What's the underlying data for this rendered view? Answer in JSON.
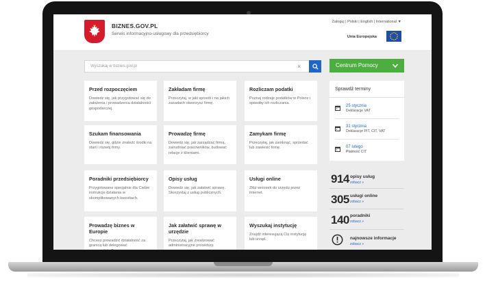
{
  "header": {
    "site_name": "BIZNES.GOV.PL",
    "site_sub": "Serwis informacyjno-usługowy dla przedsiębiorcy",
    "top_links": "Zaloguj | Polski | English | International ▼",
    "eu_label": "Unia Europejska"
  },
  "search": {
    "placeholder": "Wyszukaj w biznes.gov.pl",
    "clear_glyph": "×",
    "icon": "search-icon"
  },
  "help": {
    "label": "Centrum Pomocy",
    "icon": "chevron-down-icon"
  },
  "tiles": [
    {
      "title": "Przed rozpoczęciem",
      "desc": "Dowiedz się, jak przygotować się do założenia i prowadzenia działalności gospodarczej."
    },
    {
      "title": "Zakładam firmę",
      "desc": "Przeczytaj, w jaki sposób i na jakich zasadach otworzysz firmę."
    },
    {
      "title": "Rozliczam podatki",
      "desc": "Poznaj rodzaje podatków w Polsce i sposoby ich rozliczania."
    },
    {
      "title": "Szukam finansowania",
      "desc": "Dowiedz się, gdzie znaleźć środki na start i rozwój firmy."
    },
    {
      "title": "Prowadzę firmę",
      "desc": "Dowiedz się, jak zarządzać firmą, zatrudniać pracowników, budować relacje z klientami."
    },
    {
      "title": "Zamykam firmę",
      "desc": "Przeczytaj, jak zamknąć, sprzedać lub zawiesić firmę."
    },
    {
      "title": "Poradniki przedsiębiorcy",
      "desc": "Przygotowane specjalnie dla Ciebie instrukcje działania w skomplikowanych kwestiach."
    },
    {
      "title": "Opisy usług",
      "desc": "Dowiedz się, jak załatwić sprawę. Skorzystaj z usług publicznych."
    },
    {
      "title": "Usługi online",
      "desc": "Złóż wniosek do urzędu przez internet."
    },
    {
      "title": "Prowadzę biznes w Europie",
      "desc": "Chcesz prowadzić działalność za granicą lub delegować pracowników?"
    },
    {
      "title": "Jak załatwić sprawę w urzędzie",
      "desc": "Przeczytaj, jak zrealizować administracyjne procedury."
    },
    {
      "title": "Wyszukaj instytucję",
      "desc": "Znajdź interesującą Cię instytucję lub urząd."
    }
  ],
  "terms": {
    "title": "Sprawdź terminy",
    "items": [
      {
        "date": "25 stycznia",
        "desc": "Deklaracje VAT"
      },
      {
        "date": "31 stycznia",
        "desc": "Deklaracje PIT, CIT, VAT"
      },
      {
        "date": "07 lutego",
        "desc": "Płatność CIT"
      }
    ]
  },
  "stats": [
    {
      "number": "914",
      "label": "opisy usług",
      "link": "zobacz »"
    },
    {
      "number": "305",
      "label": "usługi online",
      "link": "zobacz »"
    },
    {
      "number": "140",
      "label": "poradniki",
      "link": "zobacz »"
    }
  ],
  "news": {
    "label": "najnowsze informacje",
    "link": "zobacz »",
    "icon": "info-icon"
  },
  "colors": {
    "accent_blue": "#1f66c8",
    "help_green": "#4bae3e",
    "emblem_red": "#d61c2c",
    "eu_blue": "#1f4ea8"
  }
}
